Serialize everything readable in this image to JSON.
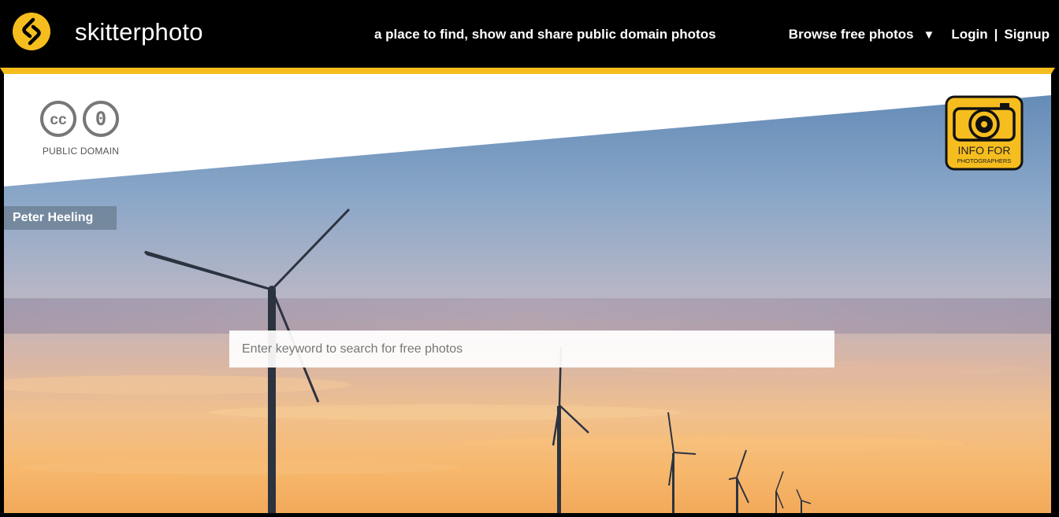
{
  "header": {
    "brand": "skitterphoto",
    "tagline": "a place to find, show and share public domain photos",
    "browse_label": "Browse free photos",
    "browse_caret": "▼",
    "login_label": "Login",
    "separator": "|",
    "signup_label": "Signup"
  },
  "hero": {
    "license_text": "PUBLIC DOMAIN",
    "license_cc": "cc",
    "license_zero": "0",
    "author": "Peter Heeling",
    "search_placeholder": "Enter keyword to search for free photos",
    "info_line1": "INFO FOR",
    "info_line2": "PHOTOGRAPHERS"
  },
  "colors": {
    "accent": "#f6bd1e",
    "header_bg": "#000000",
    "author_bg": "#6e8296"
  },
  "icons": [
    "skitterphoto-logo-icon",
    "creative-commons-icon",
    "cc-zero-icon",
    "camera-icon",
    "caret-down-icon"
  ]
}
